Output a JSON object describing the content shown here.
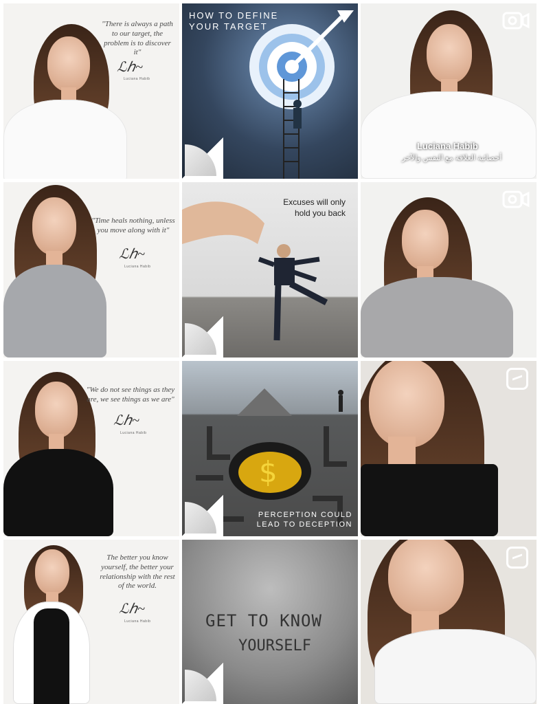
{
  "tiles": [
    {
      "kind": "quote",
      "quote": "\"There is always a path to our target, the problem is to discover it\"",
      "signature_name": "Luciana Habib"
    },
    {
      "kind": "title",
      "title_line1": "HOW TO DEFINE",
      "title_line2": "YOUR TARGET"
    },
    {
      "kind": "video",
      "caption_name": "Luciana Habib",
      "caption_arabic": "أخصائية العلاقة مع النفس والآخر",
      "badge": "camera-icon"
    },
    {
      "kind": "quote",
      "quote": "\"Time heals nothing, unless you move along with it\"",
      "signature_name": "Luciana Habib"
    },
    {
      "kind": "title",
      "title_line1": "Excuses will only",
      "title_line2": "hold you back"
    },
    {
      "kind": "video",
      "badge": "camera-icon"
    },
    {
      "kind": "quote",
      "quote": "\"We do not see things as they are, we see things as we are\"",
      "signature_name": "Luciana Habib"
    },
    {
      "kind": "title",
      "title_line1": "PERCEPTION COULD",
      "title_line2": "LEAD TO DECEPTION"
    },
    {
      "kind": "video",
      "badge": "igtv-icon"
    },
    {
      "kind": "quote",
      "quote": "The better you know yourself, the better your relationship with the rest of the world.",
      "signature_name": "Luciana Habib"
    },
    {
      "kind": "title",
      "title_line1": "GET TO KNOW",
      "title_line2": "YOURSELF"
    },
    {
      "kind": "video",
      "badge": "igtv-icon"
    }
  ],
  "colors": {
    "page_bg": "#ffffff",
    "tile_light": "#f2f2f0",
    "target_bg": "#3a4a5c",
    "target_glow": "#cfe6ff"
  }
}
